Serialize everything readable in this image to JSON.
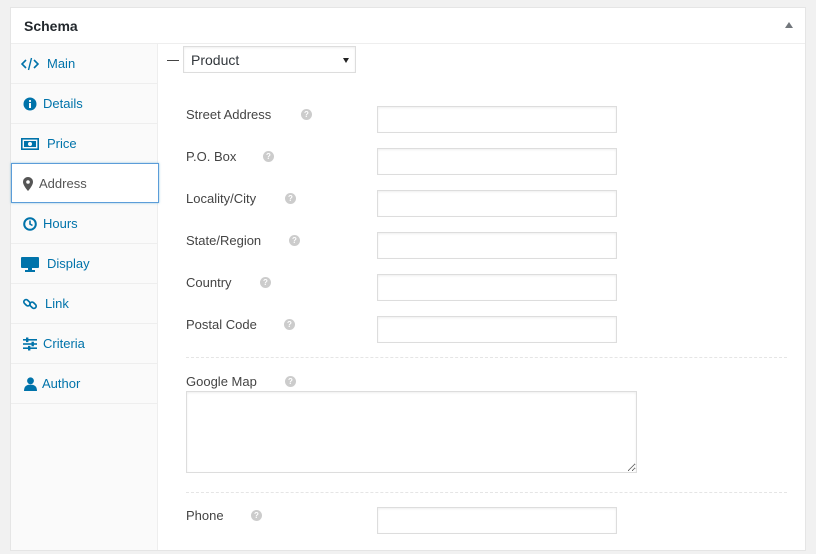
{
  "metabox": {
    "title": "Schema"
  },
  "tabs": [
    {
      "id": "main",
      "label": "Main",
      "icon": "code-icon"
    },
    {
      "id": "details",
      "label": "Details",
      "icon": "info-icon"
    },
    {
      "id": "price",
      "label": "Price",
      "icon": "money-icon"
    },
    {
      "id": "address",
      "label": "Address",
      "icon": "location-pin-icon",
      "active": true
    },
    {
      "id": "hours",
      "label": "Hours",
      "icon": "clock-icon"
    },
    {
      "id": "display",
      "label": "Display",
      "icon": "desktop-icon"
    },
    {
      "id": "link",
      "label": "Link",
      "icon": "link-icon"
    },
    {
      "id": "criteria",
      "label": "Criteria",
      "icon": "sliders-icon"
    },
    {
      "id": "author",
      "label": "Author",
      "icon": "user-icon"
    }
  ],
  "type_select": {
    "value": "Product"
  },
  "fields": {
    "street_address": {
      "label": "Street Address",
      "value": ""
    },
    "po_box": {
      "label": "P.O. Box",
      "value": ""
    },
    "locality": {
      "label": "Locality/City",
      "value": ""
    },
    "state": {
      "label": "State/Region",
      "value": ""
    },
    "country": {
      "label": "Country",
      "value": ""
    },
    "postal_code": {
      "label": "Postal Code",
      "value": ""
    },
    "google_map": {
      "label": "Google Map",
      "value": ""
    },
    "phone": {
      "label": "Phone",
      "value": ""
    }
  },
  "help_glyph": "?",
  "colors": {
    "link": "#0073aa",
    "active_border": "#5b9dd9",
    "help_icon": "#cccccc"
  }
}
